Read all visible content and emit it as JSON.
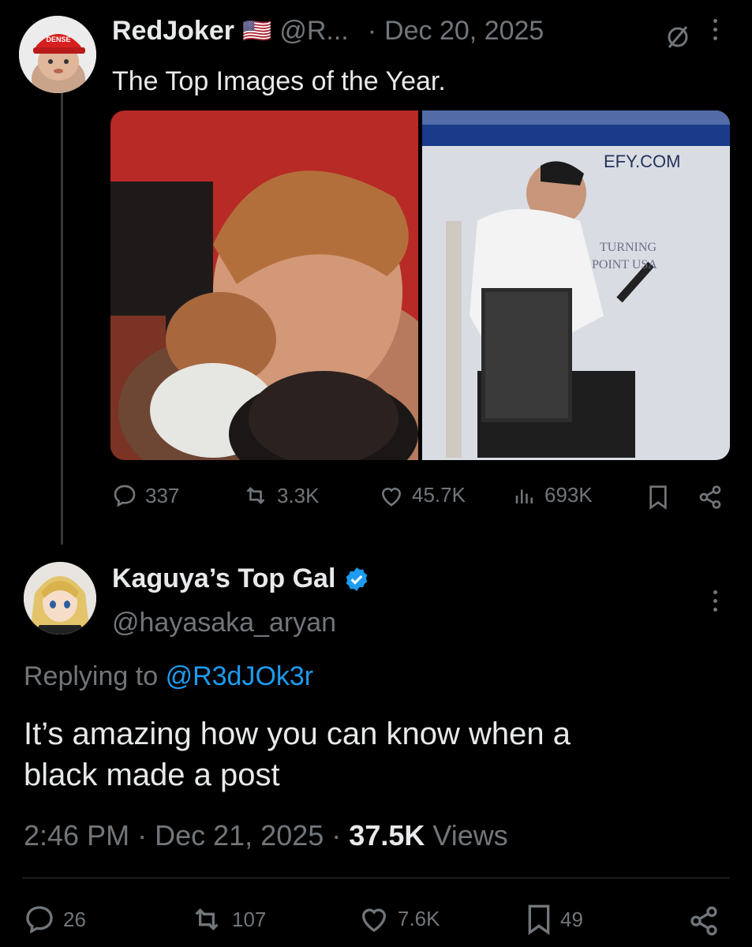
{
  "tweet": {
    "author_name": "RedJoker",
    "flag": "🇺🇸",
    "handle": "@R...",
    "separator": "·",
    "date": "Dec 20, 2025",
    "text": "The Top Images of the Year.",
    "avatar_cap_text": "DENSE",
    "image_right_text_1": "EFY.COM",
    "image_right_text_2": "TURNING",
    "image_right_text_3": "POINT USA",
    "stats": {
      "replies": "337",
      "reposts": "3.3K",
      "likes": "45.7K",
      "views": "693K"
    }
  },
  "reply": {
    "author_name": "Kaguya’s Top Gal",
    "handle": "@hayasaka_aryan",
    "replying_prefix": "Replying to",
    "replying_handle": "@R3dJOk3r",
    "text_line1": "It’s amazing how you can know when a",
    "text_line2": "black made a post",
    "time": "2:46 PM",
    "sep1": "·",
    "date": "Dec 21, 2025",
    "sep2": "·",
    "views_count": "37.5K",
    "views_label": "Views",
    "stats": {
      "replies": "26",
      "reposts": "107",
      "likes": "7.6K",
      "bookmarks": "49"
    }
  },
  "colors": {
    "background": "#000000",
    "text": "#e7e9ea",
    "muted": "#71767b",
    "link": "#1d9bf0",
    "verified": "#1d9bf0"
  }
}
